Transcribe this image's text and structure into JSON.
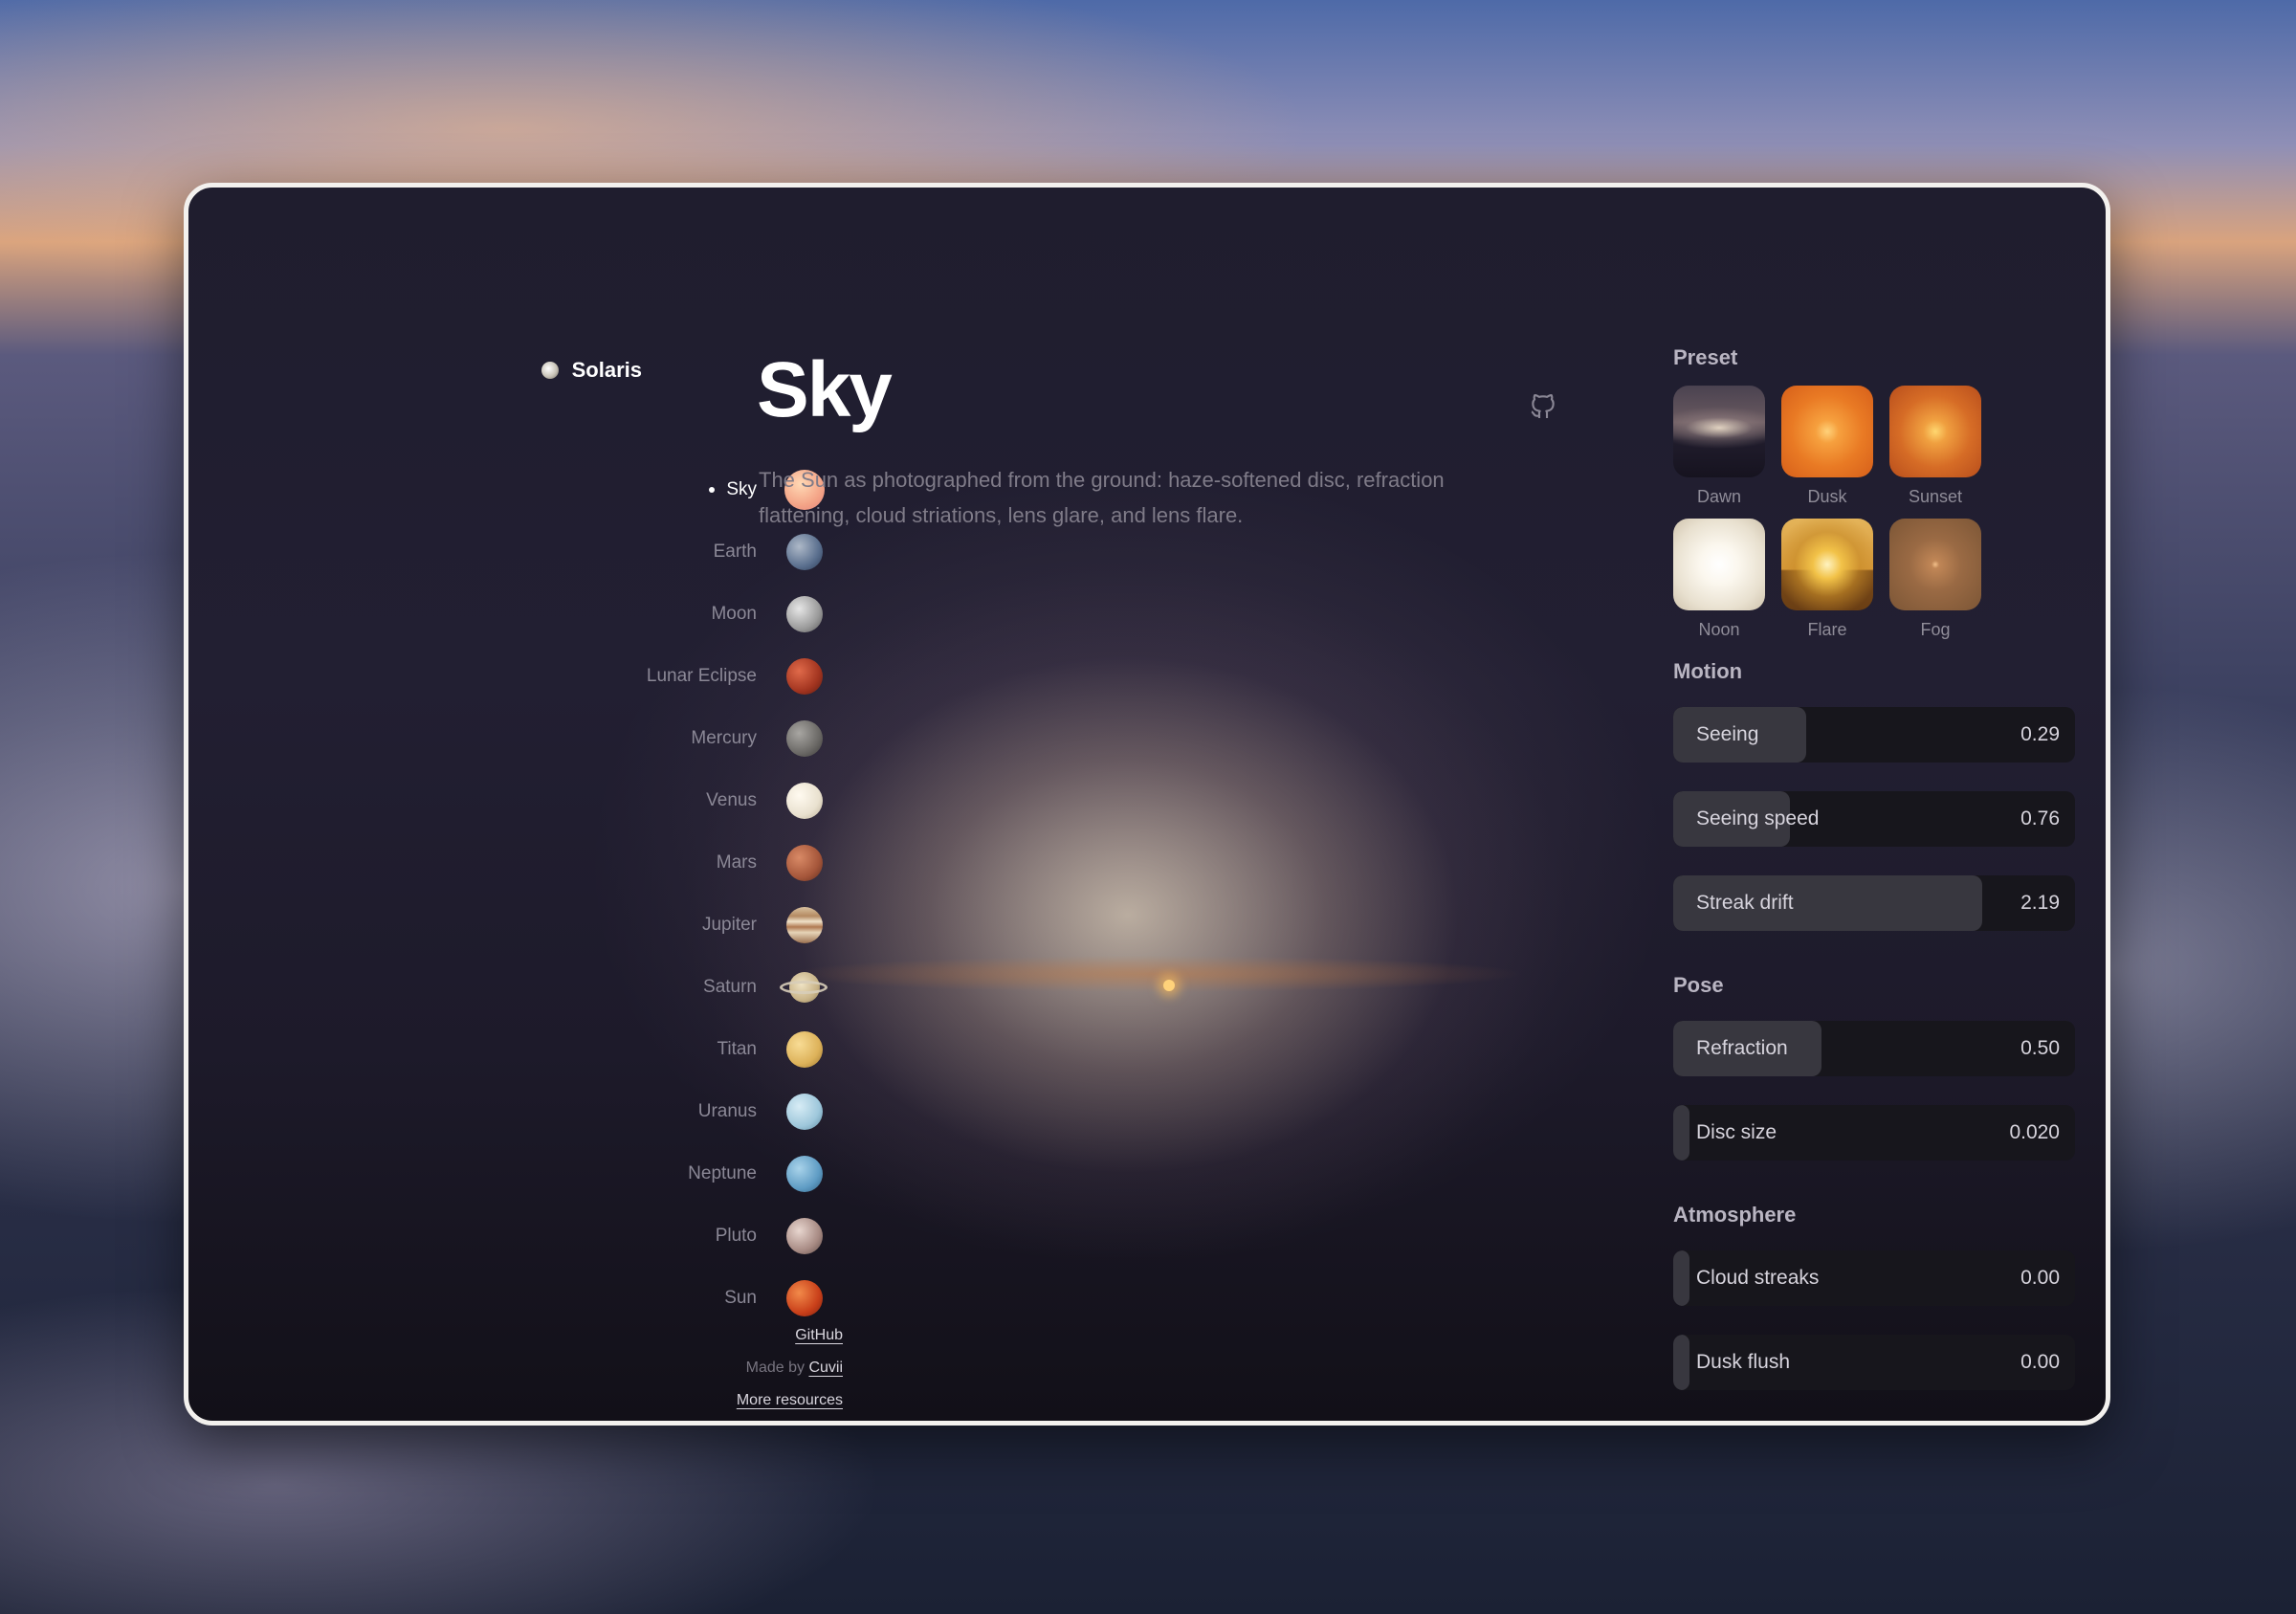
{
  "app": {
    "name": "Solaris"
  },
  "nav": {
    "items": [
      {
        "label": "Sky",
        "active": true,
        "icon": "sky-planet-icon"
      },
      {
        "label": "Earth",
        "icon": "earth-planet-icon"
      },
      {
        "label": "Moon",
        "icon": "moon-planet-icon"
      },
      {
        "label": "Lunar Eclipse",
        "icon": "lunar-eclipse-planet-icon"
      },
      {
        "label": "Mercury",
        "icon": "mercury-planet-icon"
      },
      {
        "label": "Venus",
        "icon": "venus-planet-icon"
      },
      {
        "label": "Mars",
        "icon": "mars-planet-icon"
      },
      {
        "label": "Jupiter",
        "icon": "jupiter-planet-icon"
      },
      {
        "label": "Saturn",
        "icon": "saturn-planet-icon"
      },
      {
        "label": "Titan",
        "icon": "titan-planet-icon"
      },
      {
        "label": "Uranus",
        "icon": "uranus-planet-icon"
      },
      {
        "label": "Neptune",
        "icon": "neptune-planet-icon"
      },
      {
        "label": "Pluto",
        "icon": "pluto-planet-icon"
      },
      {
        "label": "Sun",
        "icon": "sun-planet-icon"
      }
    ]
  },
  "footer": {
    "github": "GitHub",
    "made_by_prefix": "Made by",
    "made_by_link": "Cuvii",
    "more": "More resources"
  },
  "main": {
    "title": "Sky",
    "description": "The Sun as photographed from the ground: haze-softened disc, refraction flattening, cloud striations, lens glare, and lens flare.",
    "github_icon": "github-icon"
  },
  "panel": {
    "preset_title": "Preset",
    "presets": [
      {
        "label": "Dawn"
      },
      {
        "label": "Dusk"
      },
      {
        "label": "Sunset"
      },
      {
        "label": "Noon"
      },
      {
        "label": "Flare"
      },
      {
        "label": "Fog"
      }
    ],
    "motion_title": "Motion",
    "motion": [
      {
        "label": "Seeing",
        "value": "0.29",
        "fill": 0.33
      },
      {
        "label": "Seeing speed",
        "value": "0.76",
        "fill": 0.29
      },
      {
        "label": "Streak drift",
        "value": "2.19",
        "fill": 0.77
      }
    ],
    "pose_title": "Pose",
    "pose": [
      {
        "label": "Refraction",
        "value": "0.50",
        "fill": 0.37
      },
      {
        "label": "Disc size",
        "value": "0.020",
        "fill": 0.04
      }
    ],
    "atmosphere_title": "Atmosphere",
    "atmosphere": [
      {
        "label": "Cloud streaks",
        "value": "0.00",
        "fill": 0.04
      },
      {
        "label": "Dusk flush",
        "value": "0.00",
        "fill": 0.04
      }
    ]
  },
  "colors": {
    "accent": "#ffffff",
    "muted_text": "#8b8896",
    "slider_track": "#17161c",
    "slider_fill": "#38373f"
  }
}
